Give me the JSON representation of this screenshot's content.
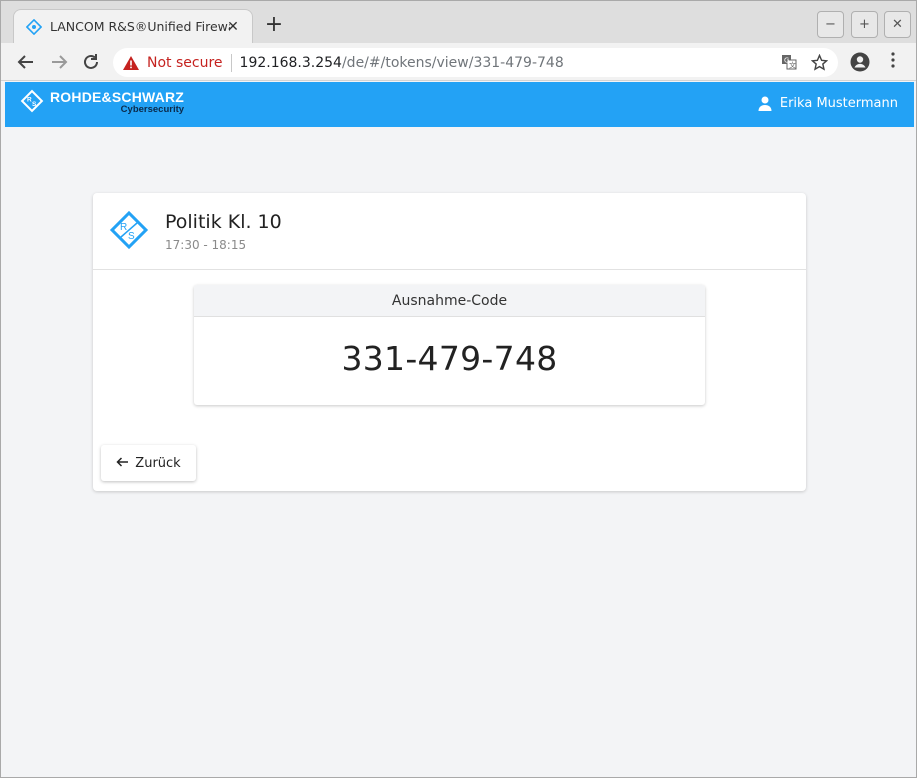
{
  "browser": {
    "tab_title": "LANCOM R&S®Unified Firewall",
    "tab_close": "✕",
    "new_tab": "+",
    "security_label": "Not secure",
    "url_host": "192.168.3.254",
    "url_path": "/de/#/tokens/view/331-479-748",
    "window_controls": [
      "−",
      "+",
      "✕"
    ]
  },
  "header": {
    "brand_name": "ROHDE&SCHWARZ",
    "brand_sub": "Cybersecurity",
    "user_name": "Erika Mustermann"
  },
  "card": {
    "title": "Politik Kl. 10",
    "time": "17:30 - 18:15",
    "code_label": "Ausnahme-Code",
    "code_value": "331-479-748",
    "back_label": "Zurück"
  },
  "colors": {
    "header_bg": "#23a2f5",
    "logo_blue": "#23a2f5",
    "not_secure": "#c5221f"
  }
}
